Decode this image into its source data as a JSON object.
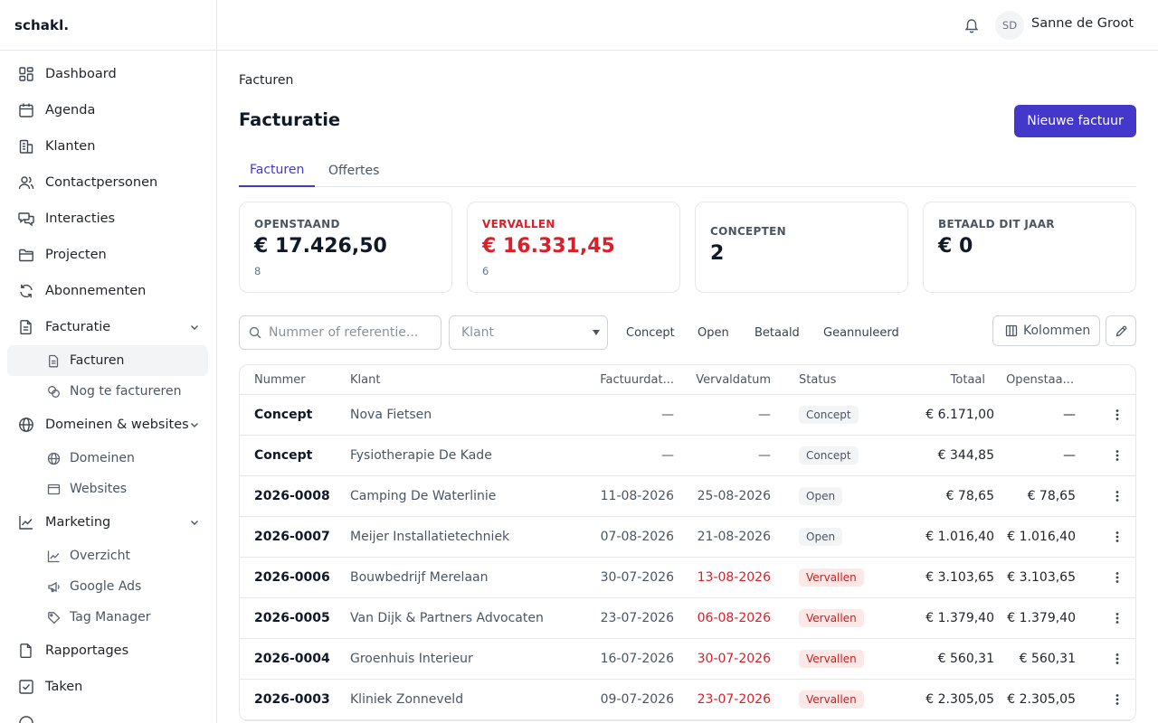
{
  "brand": "schakl.",
  "topbar": {
    "avatar_initials": "SD",
    "user_name": "Sanne de Groot"
  },
  "sidebar": {
    "items": [
      {
        "label": "Dashboard",
        "icon": "grid-icon"
      },
      {
        "label": "Agenda",
        "icon": "calendar-icon"
      },
      {
        "label": "Klanten",
        "icon": "building-icon"
      },
      {
        "label": "Contactpersonen",
        "icon": "users-icon"
      },
      {
        "label": "Interacties",
        "icon": "chat-icon"
      },
      {
        "label": "Projecten",
        "icon": "folder-icon"
      },
      {
        "label": "Abonnementen",
        "icon": "refresh-icon"
      }
    ],
    "facturatie": {
      "label": "Facturatie",
      "children": [
        {
          "label": "Facturen"
        },
        {
          "label": "Nog te factureren"
        }
      ]
    },
    "domeinen": {
      "label": "Domeinen & websites",
      "children": [
        {
          "label": "Domeinen"
        },
        {
          "label": "Websites"
        }
      ]
    },
    "marketing": {
      "label": "Marketing",
      "children": [
        {
          "label": "Overzicht"
        },
        {
          "label": "Google Ads"
        },
        {
          "label": "Tag Manager"
        }
      ]
    },
    "bottom": [
      {
        "label": "Rapportages"
      },
      {
        "label": "Taken"
      }
    ]
  },
  "main": {
    "breadcrumb": "Facturen",
    "title": "Facturatie",
    "new_button": "Nieuwe factuur",
    "tabs": [
      {
        "label": "Facturen"
      },
      {
        "label": "Offertes"
      }
    ],
    "stats": [
      {
        "label": "OPENSTAAND",
        "value": "€ 17.426,50",
        "sub": "8"
      },
      {
        "label": "VERVALLEN",
        "value": "€ 16.331,45",
        "sub": "6"
      },
      {
        "label": "CONCEPTEN",
        "value": "2"
      },
      {
        "label": "BETAALD DIT JAAR",
        "value": "€ 0"
      }
    ],
    "search_placeholder": "Nummer of referentie...",
    "client_select": "Klant",
    "filters": [
      "Concept",
      "Open",
      "Betaald",
      "Geannuleerd"
    ],
    "columns_button": "Kolommen",
    "table": {
      "headers": {
        "nummer": "Nummer",
        "klant": "Klant",
        "factuurdatum": "Factuurdat...",
        "vervaldatum": "Vervaldatum",
        "status": "Status",
        "totaal": "Totaal",
        "openstaand": "Openstaa..."
      },
      "rows": [
        {
          "nummer": "Concept",
          "klant": "Nova Fietsen",
          "factuurdatum": "—",
          "vervaldatum": "—",
          "status": "Concept",
          "totaal": "€ 6.171,00",
          "openstaand": "—"
        },
        {
          "nummer": "Concept",
          "klant": "Fysiotherapie De Kade",
          "factuurdatum": "—",
          "vervaldatum": "—",
          "status": "Concept",
          "totaal": "€ 344,85",
          "openstaand": "—"
        },
        {
          "nummer": "2026-0008",
          "klant": "Camping De Waterlinie",
          "factuurdatum": "11-08-2026",
          "vervaldatum": "25-08-2026",
          "status": "Open",
          "totaal": "€ 78,65",
          "openstaand": "€ 78,65"
        },
        {
          "nummer": "2026-0007",
          "klant": "Meijer Installatietechniek",
          "factuurdatum": "07-08-2026",
          "vervaldatum": "21-08-2026",
          "status": "Open",
          "totaal": "€ 1.016,40",
          "openstaand": "€ 1.016,40"
        },
        {
          "nummer": "2026-0006",
          "klant": "Bouwbedrijf Merelaan",
          "factuurdatum": "30-07-2026",
          "vervaldatum": "13-08-2026",
          "status": "Vervallen",
          "totaal": "€ 3.103,65",
          "openstaand": "€ 3.103,65"
        },
        {
          "nummer": "2026-0005",
          "klant": "Van Dijk & Partners Advocaten",
          "factuurdatum": "23-07-2026",
          "vervaldatum": "06-08-2026",
          "status": "Vervallen",
          "totaal": "€ 1.379,40",
          "openstaand": "€ 1.379,40"
        },
        {
          "nummer": "2026-0004",
          "klant": "Groenhuis Interieur",
          "factuurdatum": "16-07-2026",
          "vervaldatum": "30-07-2026",
          "status": "Vervallen",
          "totaal": "€ 560,31",
          "openstaand": "€ 560,31"
        },
        {
          "nummer": "2026-0003",
          "klant": "Kliniek Zonneveld",
          "factuurdatum": "09-07-2026",
          "vervaldatum": "23-07-2026",
          "status": "Vervallen",
          "totaal": "€ 2.305,05",
          "openstaand": "€ 2.305,05"
        }
      ]
    }
  },
  "colors": {
    "accent": "#4338ca",
    "danger": "#dc1e28",
    "border": "#e5e7eb"
  }
}
